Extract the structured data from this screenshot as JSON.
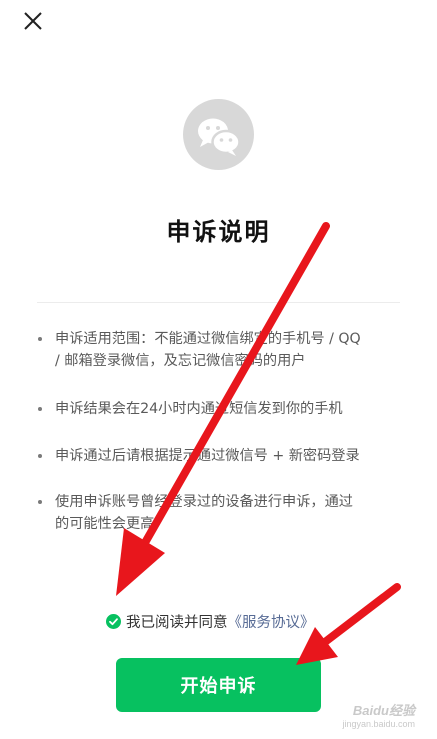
{
  "header": {
    "close_icon": "close-icon"
  },
  "logo": {
    "icon": "wechat-logo-icon",
    "background": "#d8d8d8"
  },
  "title": "申诉说明",
  "rules": [
    {
      "line1": "申诉适用范围：不能通过微信绑定的手机号 / QQ",
      "line2": "/ 邮箱登录微信，及忘记微信密码的用户"
    },
    {
      "line1": "申诉结果会在24小时内通过短信发到你的手机"
    },
    {
      "line1": "申诉通过后请根据提示通过微信号 + 新密码登录"
    },
    {
      "line1": "使用申诉账号曾经登录过的设备进行申诉，通过",
      "line2": "的可能性会更高"
    }
  ],
  "agreement": {
    "checked": true,
    "prefix": "我已阅读并同意",
    "link": "《服务协议》",
    "check_icon": "checkmark-circle-icon"
  },
  "button": {
    "label": "开始申诉"
  },
  "watermark": {
    "brand": "Baidu经验",
    "url": "jingyan.baidu.com"
  },
  "colors": {
    "accent": "#07c160",
    "link": "#576b95",
    "annotation": "#e8161c"
  }
}
